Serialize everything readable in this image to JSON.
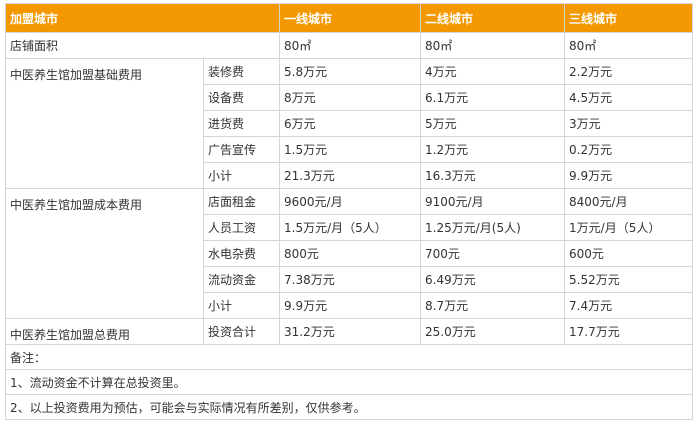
{
  "header": {
    "col_0": "加盟城市",
    "col_1": "一线城市",
    "col_2": "二线城市",
    "col_3": "三线城市"
  },
  "store_area": {
    "label": "店铺面积",
    "values": [
      "80㎡",
      "80㎡",
      "80㎡"
    ]
  },
  "groups": [
    {
      "label": "中医养生馆加盟基础费用",
      "rows": [
        {
          "item": "装修费",
          "values": [
            "5.8万元",
            "4万元",
            "2.2万元"
          ]
        },
        {
          "item": "设备费",
          "values": [
            "8万元",
            "6.1万元",
            "4.5万元"
          ]
        },
        {
          "item": "进货费",
          "values": [
            "6万元",
            "5万元",
            "3万元"
          ]
        },
        {
          "item": "广告宣传",
          "values": [
            "1.5万元",
            "1.2万元",
            "0.2万元"
          ]
        },
        {
          "item": "小计",
          "values": [
            "21.3万元",
            "16.3万元",
            "9.9万元"
          ]
        }
      ]
    },
    {
      "label": "中医养生馆加盟成本费用",
      "rows": [
        {
          "item": "店面租金",
          "values": [
            "9600元/月",
            "9100元/月",
            "8400元/月"
          ]
        },
        {
          "item": "人员工资",
          "values": [
            "1.5万元/月（5人）",
            "1.25万元/月(5人)",
            "1万元/月（5人）"
          ]
        },
        {
          "item": "水电杂费",
          "values": [
            "800元",
            "700元",
            "600元"
          ]
        },
        {
          "item": "流动资金",
          "values": [
            "7.38万元",
            "6.49万元",
            "5.52万元"
          ]
        },
        {
          "item": "小计",
          "values": [
            "9.9万元",
            "8.7万元",
            "7.4万元"
          ]
        }
      ]
    },
    {
      "label": "中医养生馆加盟总费用",
      "rows": [
        {
          "item": "投资合计",
          "values": [
            "31.2万元",
            "25.0万元",
            "17.7万元"
          ]
        }
      ]
    }
  ],
  "notes": {
    "title": "备注：",
    "line_1": "1、流动资金不计算在总投资里。",
    "line_2": "2、以上投资费用为预估，可能会与实际情况有所差别，仅供参考。"
  },
  "colors": {
    "header_bg": "#f39800",
    "header_text": "#ffffff",
    "border": "#d6d6d6",
    "text": "#333333"
  }
}
